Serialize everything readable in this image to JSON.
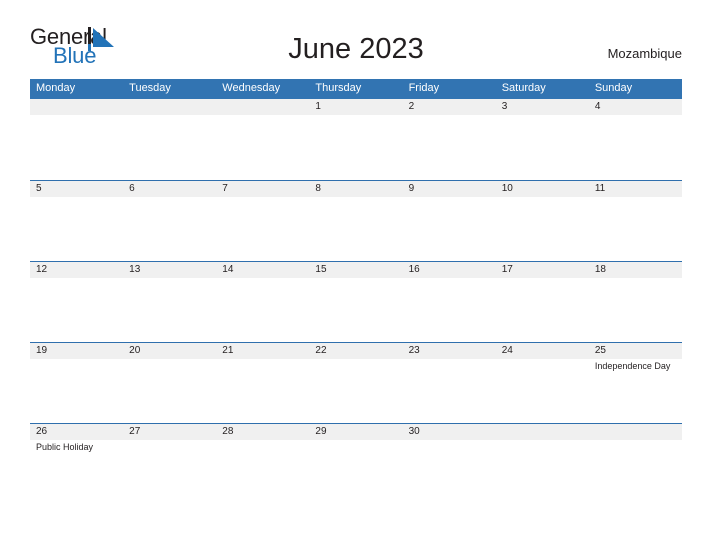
{
  "header": {
    "logo": {
      "word_one": "General",
      "word_two": "Blue",
      "mark_name": "triangle-flag-mark"
    },
    "title": "June 2023",
    "country": "Mozambique"
  },
  "calendar": {
    "day_headers": [
      "Monday",
      "Tuesday",
      "Wednesday",
      "Thursday",
      "Friday",
      "Saturday",
      "Sunday"
    ],
    "weeks": [
      {
        "days": [
          {
            "number": "",
            "event": ""
          },
          {
            "number": "",
            "event": ""
          },
          {
            "number": "",
            "event": ""
          },
          {
            "number": "1",
            "event": ""
          },
          {
            "number": "2",
            "event": ""
          },
          {
            "number": "3",
            "event": ""
          },
          {
            "number": "4",
            "event": ""
          }
        ]
      },
      {
        "days": [
          {
            "number": "5",
            "event": ""
          },
          {
            "number": "6",
            "event": ""
          },
          {
            "number": "7",
            "event": ""
          },
          {
            "number": "8",
            "event": ""
          },
          {
            "number": "9",
            "event": ""
          },
          {
            "number": "10",
            "event": ""
          },
          {
            "number": "11",
            "event": ""
          }
        ]
      },
      {
        "days": [
          {
            "number": "12",
            "event": ""
          },
          {
            "number": "13",
            "event": ""
          },
          {
            "number": "14",
            "event": ""
          },
          {
            "number": "15",
            "event": ""
          },
          {
            "number": "16",
            "event": ""
          },
          {
            "number": "17",
            "event": ""
          },
          {
            "number": "18",
            "event": ""
          }
        ]
      },
      {
        "days": [
          {
            "number": "19",
            "event": ""
          },
          {
            "number": "20",
            "event": ""
          },
          {
            "number": "21",
            "event": ""
          },
          {
            "number": "22",
            "event": ""
          },
          {
            "number": "23",
            "event": ""
          },
          {
            "number": "24",
            "event": ""
          },
          {
            "number": "25",
            "event": "Independence Day"
          }
        ]
      },
      {
        "days": [
          {
            "number": "26",
            "event": "Public Holiday"
          },
          {
            "number": "27",
            "event": ""
          },
          {
            "number": "28",
            "event": ""
          },
          {
            "number": "29",
            "event": ""
          },
          {
            "number": "30",
            "event": ""
          },
          {
            "number": "",
            "event": ""
          },
          {
            "number": "",
            "event": ""
          }
        ]
      }
    ]
  },
  "colors": {
    "header_blue": "#3274b2",
    "row_divider_blue": "#2f6fad",
    "date_strip_gray": "#f0f0f0",
    "logo_blue": "#2273b8",
    "text_dark": "#231f20"
  }
}
